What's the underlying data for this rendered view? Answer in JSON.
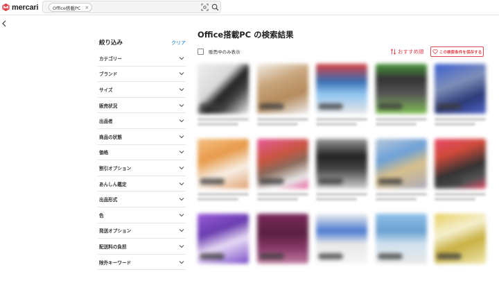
{
  "header": {
    "logo_text": "mercari",
    "search_chip": "Office搭載PC",
    "chip_close": "×"
  },
  "sidebar": {
    "title": "絞り込み",
    "clear": "クリア",
    "filters": [
      "カテゴリー",
      "ブランド",
      "サイズ",
      "販売状況",
      "出品者",
      "商品の状態",
      "価格",
      "割引オプション",
      "あんしん鑑定",
      "出品形式",
      "色",
      "発送オプション",
      "配送料の負担",
      "除外キーワード"
    ]
  },
  "main": {
    "title": "Office搭載PC の検索結果",
    "on_sale_label": "販売中のみ表示",
    "sort_label": "おすすめ順",
    "save_button": "この検索条件を保存する"
  },
  "colors": {
    "brand_red": "#e0464e",
    "link_blue": "#0073cc"
  }
}
